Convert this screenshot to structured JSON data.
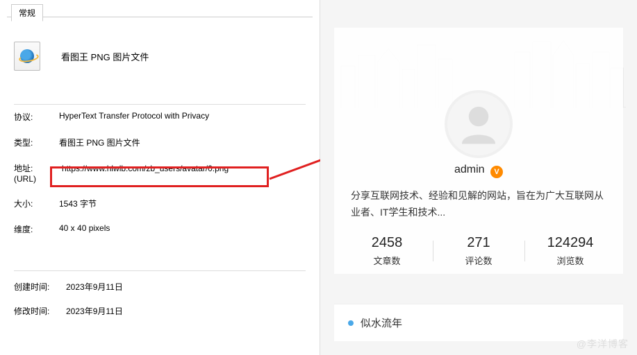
{
  "properties": {
    "tab": "常规",
    "file_title": "看图王 PNG 图片文件",
    "protocol_label": "协议:",
    "protocol_value": "HyperText Transfer Protocol with Privacy",
    "type_label": "类型:",
    "type_value": "看图王 PNG 图片文件",
    "url_label": "地址:",
    "url_sub": "(URL)",
    "url_value": "https://www.hlwlb.com/zb_users/avatar/0.png",
    "size_label": "大小:",
    "size_value": "1543 字节",
    "dim_label": "维度:",
    "dim_value": "40  x  40  pixels",
    "created_label": "创建时间:",
    "created_value": "2023年9月11日",
    "modified_label": "修改时间:",
    "modified_value": "2023年9月11日"
  },
  "profile": {
    "username": "admin",
    "verify_glyph": "V",
    "bio": "分享互联网技术、经验和见解的网站，旨在为广大互联网从业者、IT学生和技术...",
    "stats": {
      "posts_num": "2458",
      "posts_label": "文章数",
      "comments_num": "271",
      "comments_label": "评论数",
      "views_num": "124294",
      "views_label": "浏览数"
    }
  },
  "section": {
    "title": "似水流年"
  },
  "watermark": "@李洋博客"
}
